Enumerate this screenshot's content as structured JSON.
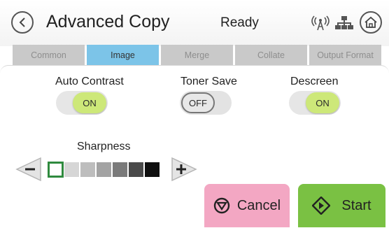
{
  "header": {
    "title": "Advanced Copy",
    "status": "Ready",
    "icons": [
      "back-icon",
      "wireless-icon",
      "network-icon",
      "home-icon"
    ]
  },
  "tabs": [
    {
      "label": "Common",
      "active": false
    },
    {
      "label": "Image",
      "active": true
    },
    {
      "label": "Merge",
      "active": false
    },
    {
      "label": "Collate",
      "active": false
    },
    {
      "label": "Output Format",
      "active": false
    }
  ],
  "options": {
    "auto_contrast": {
      "label": "Auto Contrast",
      "value": "ON"
    },
    "toner_save": {
      "label": "Toner Save",
      "value": "OFF"
    },
    "descreen": {
      "label": "Descreen",
      "value": "ON"
    }
  },
  "sharpness": {
    "label": "Sharpness",
    "level": 1,
    "max": 7,
    "colors": [
      "#ffffff",
      "#d6d6d6",
      "#bdbdbd",
      "#a3a3a3",
      "#7a7a7a",
      "#4a4a4a",
      "#0f0f0f"
    ]
  },
  "actions": {
    "cancel_label": "Cancel",
    "start_label": "Start"
  },
  "colors": {
    "active_tab": "#7cc4e8",
    "toggle_on": "#cde879",
    "cancel": "#f3a7c3",
    "start": "#7ac143",
    "selected_cell_border": "#2f8a3e"
  }
}
